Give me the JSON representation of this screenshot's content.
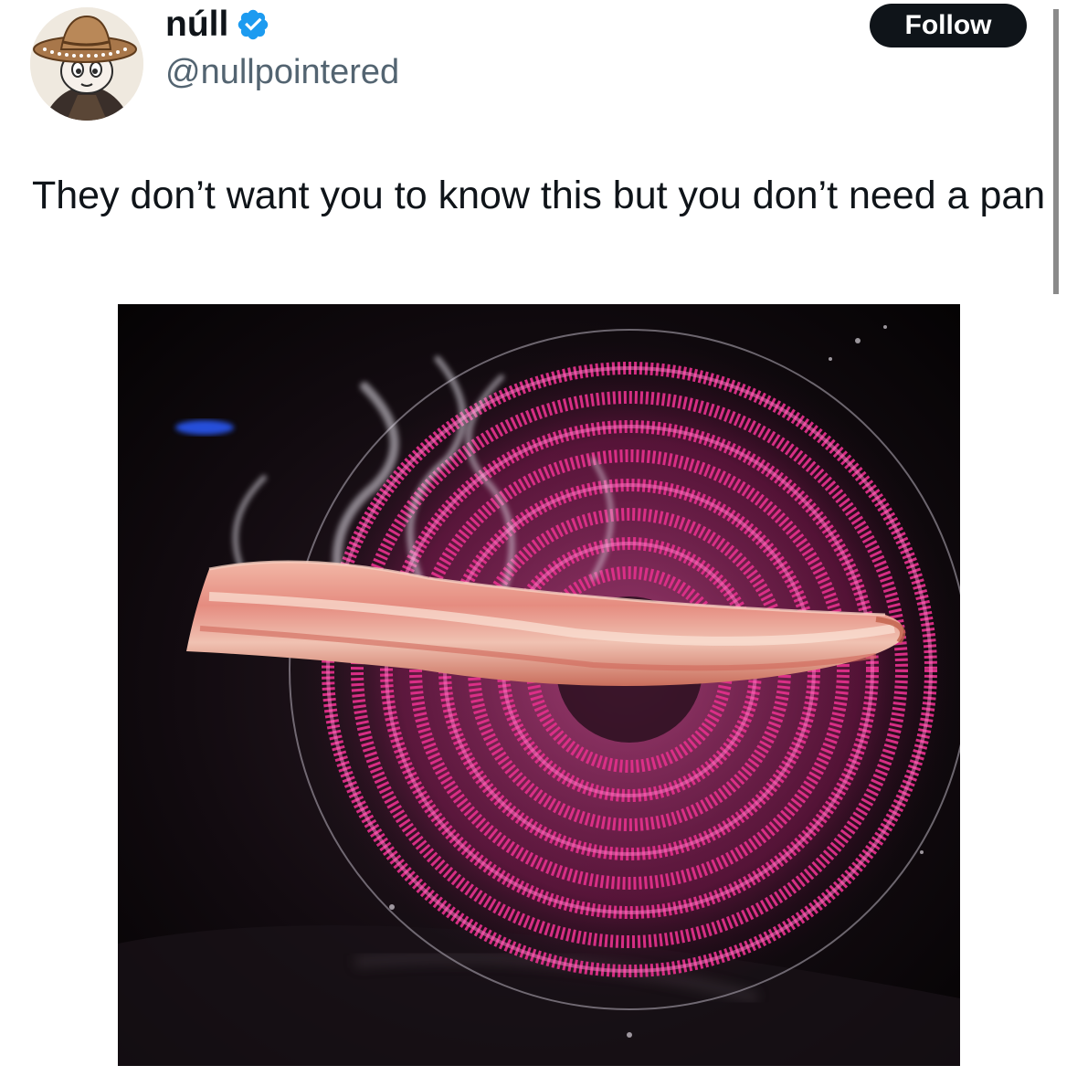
{
  "author": {
    "display_name": "núll",
    "handle": "@nullpointered",
    "verified": true,
    "verified_icon": "verified-badge-icon",
    "avatar_icon": "cartoon-sombrero-avatar"
  },
  "actions": {
    "follow_label": "Follow"
  },
  "tweet": {
    "text": "They don’t want you to know this but you don’t need a pan"
  },
  "media": {
    "subject": "bacon-on-glowing-stove-coil-photo"
  },
  "colors": {
    "text": "#0f1419",
    "secondary_text": "#536471",
    "verified": "#1d9bf0",
    "button_bg": "#0f1419",
    "button_text": "#ffffff",
    "coil_glow": "#e0308a"
  }
}
